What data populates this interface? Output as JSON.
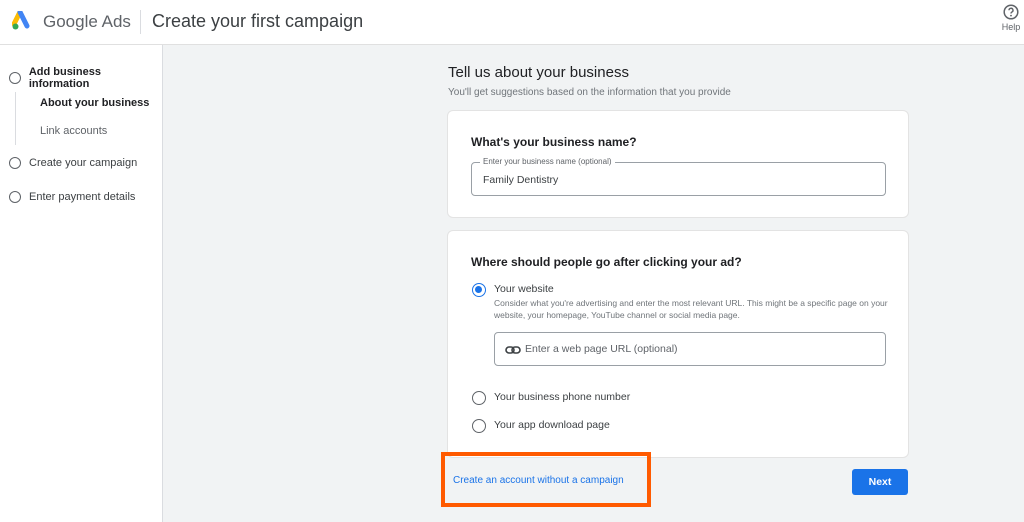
{
  "header": {
    "brand": "Google Ads",
    "title": "Create your first campaign",
    "help_label": "Help",
    "logo_icon": "google-ads-logo",
    "help_icon": "help-circle-icon"
  },
  "sidebar": {
    "steps": [
      {
        "label": "Add business information",
        "state": "current"
      },
      {
        "label": "Create your campaign",
        "state": "pending"
      },
      {
        "label": "Enter payment details",
        "state": "pending"
      }
    ],
    "substeps": [
      {
        "label": "About your business",
        "active": true
      },
      {
        "label": "Link accounts",
        "active": false
      }
    ]
  },
  "main": {
    "heading": "Tell us about your business",
    "subheading": "You'll get suggestions based on the information that you provide",
    "business_name_card": {
      "title": "What's your business name?",
      "field_label": "Enter your business name (optional)",
      "field_value": "Family Dentistry"
    },
    "destination_card": {
      "title": "Where should people go after clicking your ad?",
      "options": [
        {
          "label": "Your website",
          "selected": true,
          "description": "Consider what you're advertising and enter the most relevant URL. This might be a specific page on your website, your homepage, YouTube channel or social media page."
        },
        {
          "label": "Your business phone number",
          "selected": false
        },
        {
          "label": "Your app download page",
          "selected": false
        }
      ],
      "url_placeholder": "Enter a web page URL (optional)",
      "url_icon": "link-icon"
    },
    "no_campaign_link": "Create an account without a campaign",
    "next_label": "Next"
  },
  "colors": {
    "accent": "#1a73e8",
    "highlight": "#ff5a00",
    "background": "#f1f3f4"
  }
}
